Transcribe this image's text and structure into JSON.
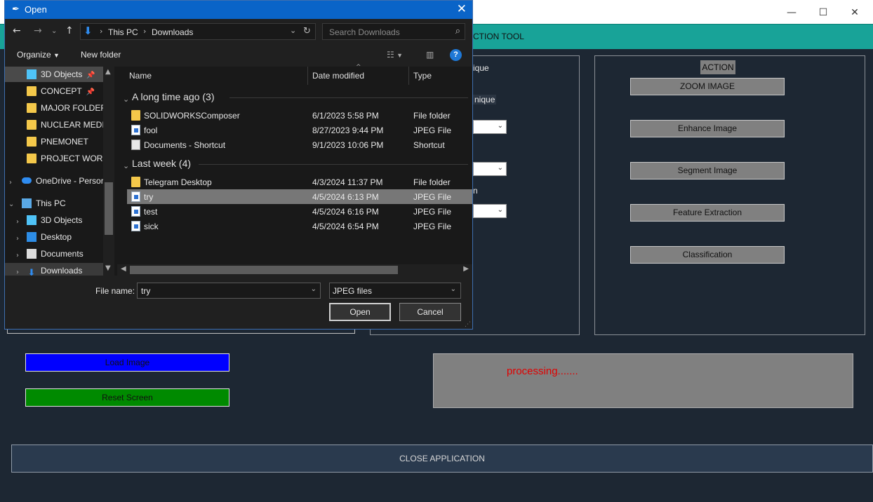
{
  "app": {
    "banner_text": "CTION TOOL",
    "window_controls": {
      "minimize": "—",
      "maximize": "☐",
      "close": "✕"
    },
    "left_panel": {
      "label1": "ique",
      "label2": "nique",
      "label3": "n"
    },
    "action_panel": {
      "title": "ACTION",
      "buttons": [
        "ZOOM IMAGE",
        "Enhance Image",
        "Segment Image",
        "Feature Extraction",
        "Classification"
      ]
    },
    "processing_text": "processing.......",
    "load_image": "Load Image",
    "reset_screen": "Reset Screen",
    "close_application": "CLOSE APPLICATION"
  },
  "dialog": {
    "title": "Open",
    "close_glyph": "✕",
    "address": {
      "segments": [
        "This PC",
        "Downloads"
      ]
    },
    "search_placeholder": "Search Downloads",
    "toolbar": {
      "organize": "Organize",
      "new_folder": "New folder",
      "help": "?"
    },
    "nav_items": [
      {
        "label": "3D Objects",
        "icon": "3d-objects-icon",
        "pinned": true
      },
      {
        "label": "CONCEPT",
        "icon": "folder-icon",
        "pinned": true
      },
      {
        "label": "MAJOR FOLDER",
        "icon": "folder-icon",
        "pinned": false
      },
      {
        "label": "NUCLEAR MEDIC",
        "icon": "folder-icon",
        "pinned": false
      },
      {
        "label": "PNEMONET",
        "icon": "folder-icon",
        "pinned": false
      },
      {
        "label": "PROJECT WORK",
        "icon": "folder-icon",
        "pinned": false
      },
      {
        "label": "OneDrive - Persor",
        "icon": "onedrive-icon",
        "pinned": false
      },
      {
        "label": "This PC",
        "icon": "computer-icon",
        "pinned": false
      },
      {
        "label": "3D Objects",
        "icon": "3d-objects-icon",
        "pinned": false
      },
      {
        "label": "Desktop",
        "icon": "desktop-icon",
        "pinned": false
      },
      {
        "label": "Documents",
        "icon": "documents-icon",
        "pinned": false
      },
      {
        "label": "Downloads",
        "icon": "downloads-icon",
        "pinned": false
      }
    ],
    "columns": {
      "name": "Name",
      "date": "Date modified",
      "type": "Type"
    },
    "groups": [
      {
        "header": "A long time ago (3)",
        "rows": [
          {
            "name": "SOLIDWORKSComposer",
            "date": "6/1/2023 5:58 PM",
            "type": "File folder",
            "icon": "folder-icon"
          },
          {
            "name": "fool",
            "date": "8/27/2023 9:44 PM",
            "type": "JPEG File",
            "icon": "jpeg-file-icon"
          },
          {
            "name": "Documents - Shortcut",
            "date": "9/1/2023 10:06 PM",
            "type": "Shortcut",
            "icon": "shortcut-icon"
          }
        ]
      },
      {
        "header": "Last week (4)",
        "rows": [
          {
            "name": "Telegram Desktop",
            "date": "4/3/2024 11:37 PM",
            "type": "File folder",
            "icon": "folder-icon"
          },
          {
            "name": "try",
            "date": "4/5/2024 6:13 PM",
            "type": "JPEG File",
            "icon": "jpeg-file-icon",
            "selected": true
          },
          {
            "name": "test",
            "date": "4/5/2024 6:16 PM",
            "type": "JPEG File",
            "icon": "jpeg-file-icon"
          },
          {
            "name": "sick",
            "date": "4/5/2024 6:54 PM",
            "type": "JPEG File",
            "icon": "jpeg-file-icon"
          }
        ]
      }
    ],
    "file_name_label": "File name:",
    "file_name_value": "try",
    "file_type_value": "JPEG files",
    "open_button": "Open",
    "cancel_button": "Cancel"
  }
}
